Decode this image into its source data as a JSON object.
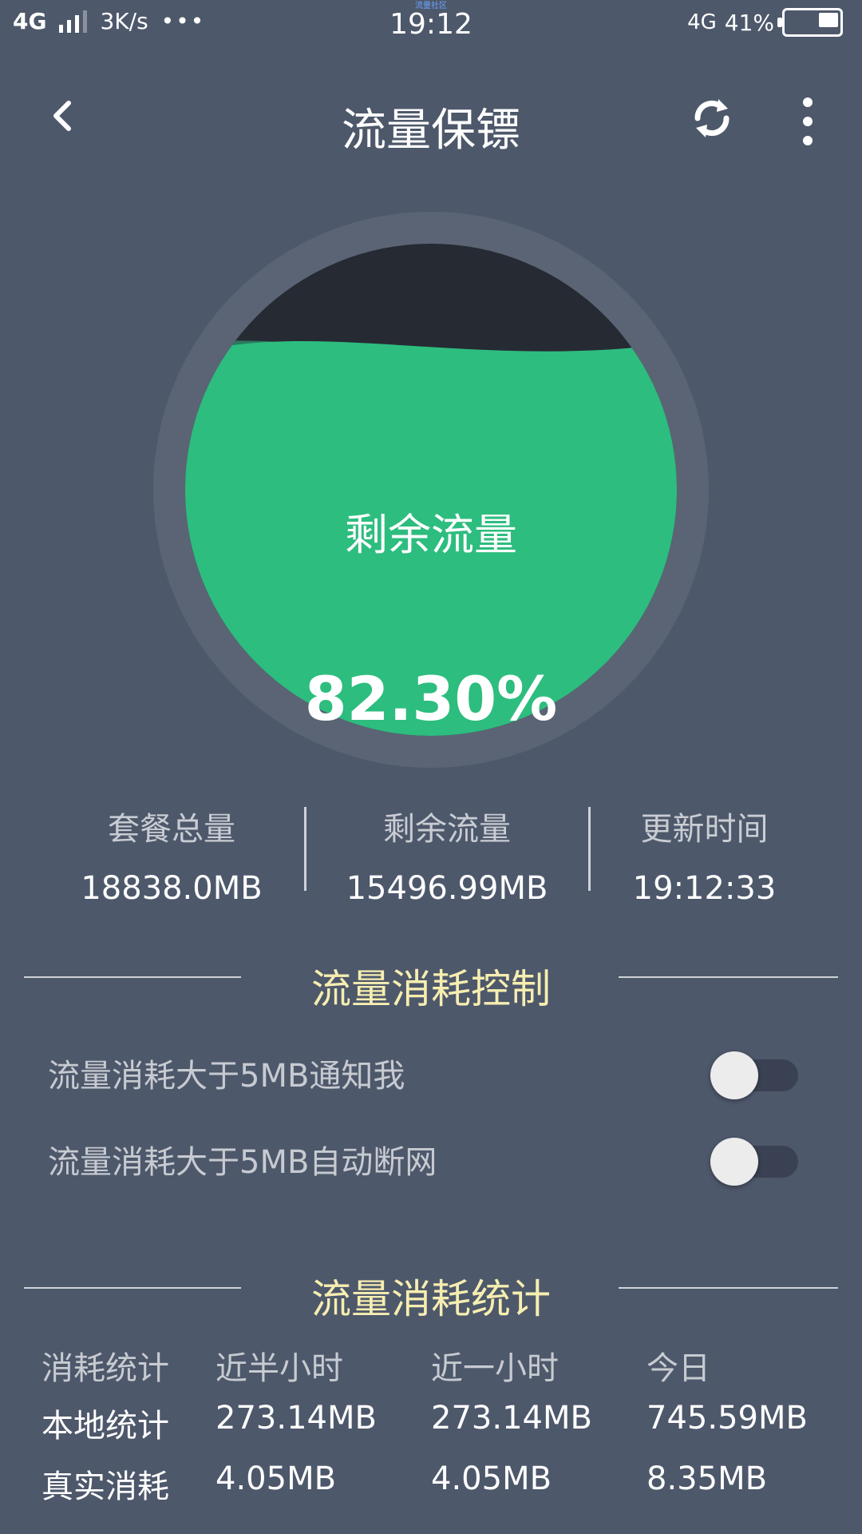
{
  "status_bar": {
    "network": "4G",
    "speed": "3K/s",
    "more": "•••",
    "time": "19:12",
    "caption": "流量社区",
    "network_right": "4G",
    "battery_percent": "41%"
  },
  "header": {
    "title": "流量保镖"
  },
  "gauge": {
    "label": "剩余流量",
    "percent_text": "82.30%",
    "percent_value": 82.3,
    "colors": {
      "ring": "#5b6474",
      "empty": "#262a33",
      "fill": "#2dbd7f",
      "fill_dark": "#2a7a5f"
    }
  },
  "stats": {
    "total": {
      "label": "套餐总量",
      "value": "18838.0MB"
    },
    "remaining": {
      "label": "剩余流量",
      "value": "15496.99MB"
    },
    "updated": {
      "label": "更新时间",
      "value": "19:12:33"
    }
  },
  "control": {
    "title": "流量消耗控制",
    "notify": {
      "label": "流量消耗大于5MB通知我",
      "enabled": false
    },
    "auto_disconnect": {
      "label": "流量消耗大于5MB自动断网",
      "enabled": false
    }
  },
  "stats_table": {
    "title": "流量消耗统计",
    "headers": [
      "消耗统计",
      "近半小时",
      "近一小时",
      "今日"
    ],
    "rows": [
      {
        "label": "本地统计",
        "values": [
          "273.14MB",
          "273.14MB",
          "745.59MB"
        ]
      },
      {
        "label": "真实消耗",
        "values": [
          "4.05MB",
          "4.05MB",
          "8.35MB"
        ]
      }
    ]
  }
}
